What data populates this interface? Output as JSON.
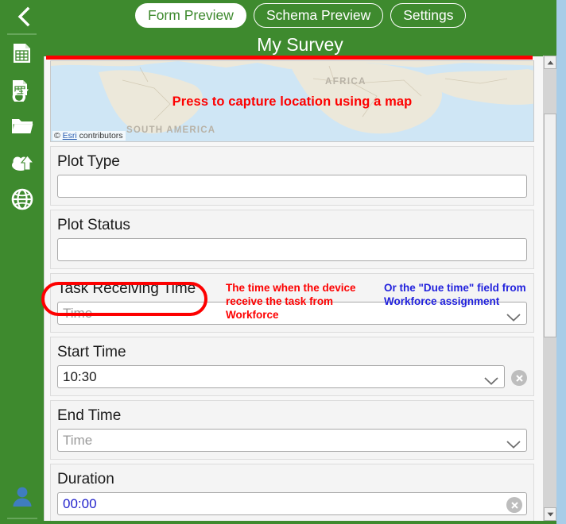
{
  "window": {
    "accent_green": "#3e8a2e",
    "annotation_red": "#fd0000",
    "annotation_blue": "#2222dd"
  },
  "topbar": {
    "back_icon": "chevron-left-icon",
    "tabs": [
      {
        "label": "Form Preview",
        "active": true
      },
      {
        "label": "Schema Preview",
        "active": false
      },
      {
        "label": "Settings",
        "active": false
      }
    ]
  },
  "header": {
    "title": "My Survey"
  },
  "sidebar": {
    "items": [
      {
        "icon": "spreadsheet-icon",
        "name": "sidebar-item-spreadsheet"
      },
      {
        "icon": "spreadsheet-refresh-icon",
        "name": "sidebar-item-refresh-spreadsheet"
      },
      {
        "icon": "folder-icon",
        "name": "sidebar-item-folder"
      },
      {
        "icon": "cloud-upload-icon",
        "name": "sidebar-item-publish"
      },
      {
        "icon": "globe-icon",
        "name": "sidebar-item-web"
      }
    ],
    "account_icon": "user-avatar-icon"
  },
  "form": {
    "map": {
      "prompt": "Press to capture location using a map",
      "continent_labels": [
        "AFRICA",
        "SOUTH AMERICA"
      ],
      "attribution_prefix": "© ",
      "attribution_link": "Esri",
      "attribution_suffix": " contributors"
    },
    "fields": [
      {
        "label": "Plot Type",
        "value": "",
        "placeholder": "",
        "type": "text",
        "has_chevron": false,
        "has_clear": false
      },
      {
        "label": "Plot Status",
        "value": "",
        "placeholder": "",
        "type": "text",
        "has_chevron": false,
        "has_clear": false
      },
      {
        "label": "Task Receiving Time",
        "value": "",
        "placeholder": "Time",
        "type": "time",
        "has_chevron": true,
        "has_clear": false
      },
      {
        "label": "Start Time",
        "value": "10:30",
        "placeholder": "",
        "type": "time",
        "has_chevron": true,
        "has_clear": true
      },
      {
        "label": "End Time",
        "value": "",
        "placeholder": "Time",
        "type": "time",
        "has_chevron": true,
        "has_clear": false
      },
      {
        "label": "Duration",
        "value": "00:00",
        "placeholder": "",
        "type": "duration",
        "has_chevron": false,
        "has_clear": true
      }
    ]
  },
  "annotations": {
    "highlight_target": "Task Receiving Time",
    "red_note": "The time when the device receive the task from Workforce",
    "blue_note": "Or the \"Due time\" field from Workforce assignment"
  },
  "scrollbar": {
    "up_arrow": "triangle-up-icon",
    "down_arrow": "triangle-down-icon"
  }
}
